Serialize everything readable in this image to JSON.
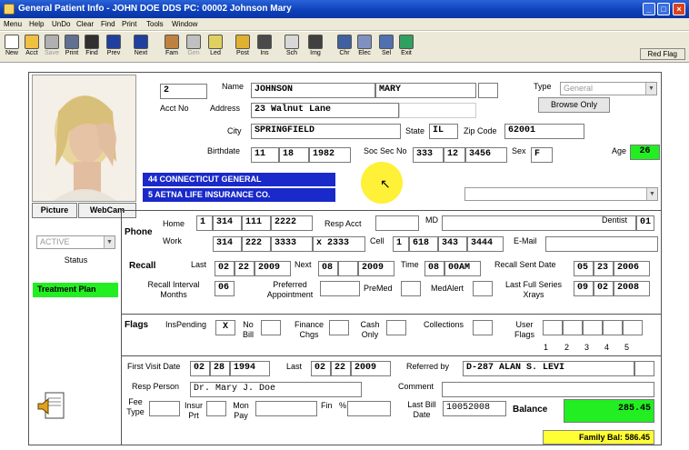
{
  "window": {
    "title": "General Patient Info - JOHN DOE  DDS PC: 00002 Johnson Mary",
    "buttons": {
      "minimize": "_",
      "maximize": "□",
      "close": "×"
    }
  },
  "menu": [
    "Menu",
    "Help",
    "UnDo",
    "Clear",
    "Find",
    "Print",
    "Tools",
    "Window"
  ],
  "toolbar": [
    {
      "label": "New",
      "icon": "new-icon",
      "color": "#ffffff"
    },
    {
      "label": "Acct",
      "icon": "folder-icon",
      "color": "#f0c040"
    },
    {
      "label": "Save",
      "icon": "save-icon",
      "color": "#b0b0b0",
      "disabled": true
    },
    {
      "label": "Print",
      "icon": "printer-icon",
      "color": "#607090"
    },
    {
      "label": "Find",
      "icon": "binoculars-icon",
      "color": "#303030"
    },
    {
      "label": "Prev",
      "icon": "arrow-left-icon",
      "color": "#2040a0"
    },
    {
      "label": "Next",
      "icon": "arrow-right-icon",
      "color": "#2040a0"
    },
    {
      "label": "Fam",
      "icon": "family-icon",
      "color": "#c08040"
    },
    {
      "label": "Gen",
      "icon": "gen-icon",
      "color": "#c0c0c0",
      "disabled": true
    },
    {
      "label": "Led",
      "icon": "ledger-icon",
      "color": "#e0d060"
    },
    {
      "label": "Post",
      "icon": "pencil-icon",
      "color": "#e0b030"
    },
    {
      "label": "Ins",
      "icon": "insurance-icon",
      "color": "#4a4a4a"
    },
    {
      "label": "Sch",
      "icon": "schedule-icon",
      "color": "#d8d8d8"
    },
    {
      "label": "Img",
      "icon": "camera-icon",
      "color": "#404040"
    },
    {
      "label": "Chr",
      "icon": "chart-icon",
      "color": "#4060a0"
    },
    {
      "label": "Elec",
      "icon": "electronic-icon",
      "color": "#8090c0"
    },
    {
      "label": "Sel",
      "icon": "select-icon",
      "color": "#5070b0"
    },
    {
      "label": "Exit",
      "icon": "exit-icon",
      "color": "#30a060"
    }
  ],
  "red_flag": "Red Flag",
  "patient": {
    "acct_no": "2",
    "acct_label": "Acct No",
    "name_label": "Name",
    "last_name": "JOHNSON",
    "first_name": "MARY",
    "address_label": "Address",
    "address": "23 Walnut Lane",
    "city_label": "City",
    "city": "SPRINGFIELD",
    "state_label": "State",
    "state": "IL",
    "zip_label": "Zip Code",
    "zip": "62001",
    "birthdate_label": "Birthdate",
    "birth_month": "11",
    "birth_day": "18",
    "birth_year": "1982",
    "ssn_label": "Soc Sec No",
    "ssn_1": "333",
    "ssn_2": "12",
    "ssn_3": "3456",
    "sex_label": "Sex",
    "sex": "F",
    "age_label": "Age",
    "age": "26",
    "type_label": "Type",
    "type_value": "General",
    "browse_only": "Browse Only"
  },
  "insurance": [
    "44 CONNECTICUT GENERAL",
    "5 AETNA LIFE INSURANCE CO."
  ],
  "picture_tabs": [
    "Picture",
    "WebCam"
  ],
  "status": {
    "value": "ACTIVE",
    "label": "Status"
  },
  "treatment_plan": "Treatment Plan",
  "phone": {
    "section": "Phone",
    "home_label": "Home",
    "home": [
      "1",
      "314",
      "111",
      "2222"
    ],
    "resp_acct_label": "Resp Acct",
    "md_label": "MD",
    "dentist_label": "Dentist",
    "dentist": "01",
    "work_label": "Work",
    "work": [
      "314",
      "222",
      "3333",
      "x 2333"
    ],
    "cell_label": "Cell",
    "cell": [
      "1",
      "618",
      "343",
      "3444"
    ],
    "email_label": "E-Mail"
  },
  "recall": {
    "section": "Recall",
    "last_label": "Last",
    "last": [
      "02",
      "22",
      "2009"
    ],
    "next_label": "Next",
    "next": [
      "08",
      "",
      "2009"
    ],
    "time_label": "Time",
    "time": [
      "08",
      "00AM"
    ],
    "sent_label": "Recall Sent Date",
    "sent": [
      "05",
      "23",
      "2006"
    ],
    "interval_label": "Recall Interval Months",
    "interval": "06",
    "preferred_label": "Preferred Appointment",
    "premed_label": "PreMed",
    "medalert_label": "MedAlert",
    "full_series_label": "Last Full Series Xrays",
    "full_series": [
      "09",
      "02",
      "2008"
    ]
  },
  "flags": {
    "section": "Flags",
    "ins_pending_label": "InsPending",
    "ins_pending": "X",
    "no_bill_label": "No Bill",
    "finance_label": "Finance Chgs",
    "cash_only_label": "Cash Only",
    "collections_label": "Collections",
    "user_flags_label": "User Flags",
    "user_flag_numbers": [
      "1",
      "2",
      "3",
      "4",
      "5"
    ]
  },
  "visits": {
    "first_visit_label": "First Visit Date",
    "first_visit": [
      "02",
      "28",
      "1994"
    ],
    "last_label": "Last",
    "last": [
      "02",
      "22",
      "2009"
    ],
    "referred_label": "Referred by",
    "referred_by": "D-287 ALAN S. LEVI",
    "resp_person_label": "Resp Person",
    "resp_person": "Dr. Mary J. Doe",
    "comment_label": "Comment",
    "fee_type_label": "Fee Type",
    "insur_prt_label": "Insur Prt",
    "mon_pay_label": "Mon Pay",
    "fin_label": "Fin",
    "pct": "%",
    "last_bill_label": "Last Bill Date",
    "last_bill": "10052008",
    "balance_label": "Balance",
    "balance": "285.45"
  },
  "family_bal": "Family Bal:  586.45",
  "colors": {
    "accent_blue": "#1a29c9",
    "green": "#22ee22",
    "yellow": "#ffff33",
    "title_bar": "#0c3fb8"
  }
}
